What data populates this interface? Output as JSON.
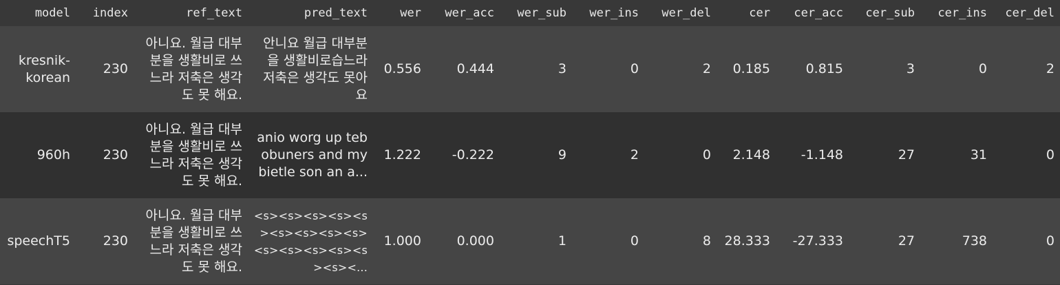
{
  "columns": [
    "model",
    "index",
    "ref_text",
    "pred_text",
    "wer",
    "wer_acc",
    "wer_sub",
    "wer_ins",
    "wer_del",
    "cer",
    "cer_acc",
    "cer_sub",
    "cer_ins",
    "cer_del"
  ],
  "rows": [
    {
      "model": "kresnik-korean",
      "index": "230",
      "ref_text": "아니요. 월급 대부분을 생활비로 쓰느라 저축은 생각도 못 해요.",
      "pred_text": "안니요 월급 대부분을 생활비로습느라 저축은 생각도 못아요",
      "wer": "0.556",
      "wer_acc": "0.444",
      "wer_sub": "3",
      "wer_ins": "0",
      "wer_del": "2",
      "cer": "0.185",
      "cer_acc": "0.815",
      "cer_sub": "3",
      "cer_ins": "0",
      "cer_del": "2"
    },
    {
      "model": "960h",
      "index": "230",
      "ref_text": "아니요. 월급 대부분을 생활비로 쓰느라 저축은 생각도 못 해요.",
      "pred_text": "anio worg up tebobuners and my bietle son an a...",
      "wer": "1.222",
      "wer_acc": "-0.222",
      "wer_sub": "9",
      "wer_ins": "2",
      "wer_del": "0",
      "cer": "2.148",
      "cer_acc": "-1.148",
      "cer_sub": "27",
      "cer_ins": "31",
      "cer_del": "0"
    },
    {
      "model": "speechT5",
      "index": "230",
      "ref_text": "아니요. 월급 대부분을 생활비로 쓰느라 저축은 생각도 못 해요.",
      "pred_text": "<s><s><s><s><s><s><s><s><s><s><s><s><s><s><s><...",
      "wer": "1.000",
      "wer_acc": "0.000",
      "wer_sub": "1",
      "wer_ins": "0",
      "wer_del": "8",
      "cer": "28.333",
      "cer_acc": "-27.333",
      "cer_sub": "27",
      "cer_ins": "738",
      "cer_del": "0"
    }
  ]
}
